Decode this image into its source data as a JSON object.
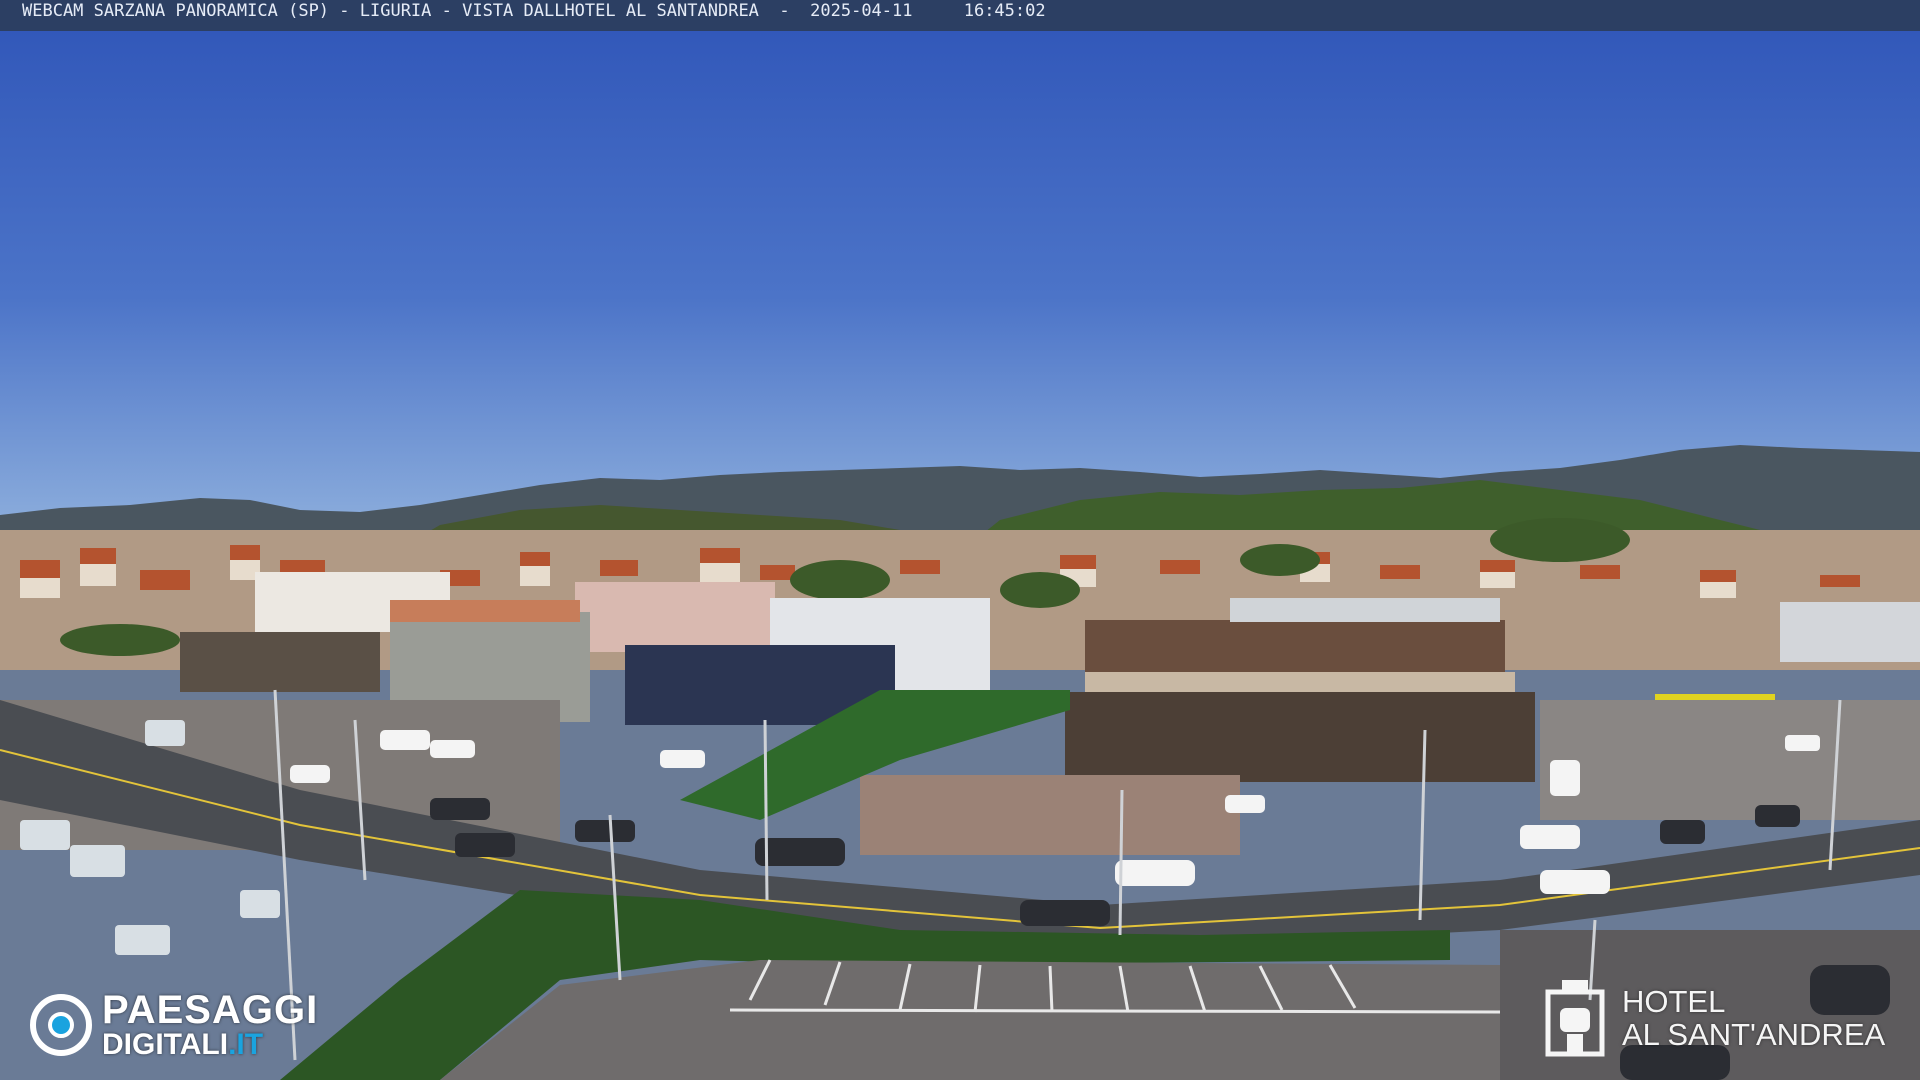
{
  "overlay": {
    "title_text": "WEBCAM SARZANA PANORAMICA (SP) - LIGURIA - VISTA DALLHOTEL AL SANTANDREA",
    "date": "2025-04-11",
    "time": "16:45:02"
  },
  "logos": {
    "left": {
      "line1": "PAESAGGI",
      "line2_main": "DIGITALI",
      "line2_suffix": ".IT"
    },
    "right": {
      "line1": "HOTEL",
      "line2": "AL SANT'ANDREA"
    }
  },
  "colors": {
    "sky_top": "#2f55b8",
    "sky_horizon": "#8fb0dd",
    "mountains": "#4a5660",
    "hills_green": "#3f5f2c",
    "road": "#4a4d52",
    "brand_blue": "#1aa3df",
    "overlay_bar": "#2c3f63"
  }
}
